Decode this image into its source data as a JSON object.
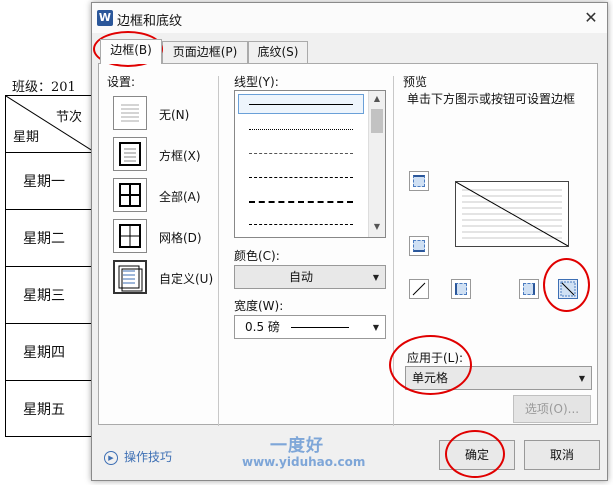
{
  "document": {
    "class_label": "班级：201",
    "header_top": "节次",
    "header_bottom": "星期",
    "rows": [
      "星期一",
      "星期二",
      "星期三",
      "星期四",
      "星期五"
    ]
  },
  "dialog": {
    "app_icon": "W",
    "title": "边框和底纹",
    "close_symbol": "✕",
    "tabs": [
      "边框(B)",
      "页面边框(P)",
      "底纹(S)"
    ],
    "settings_label": "设置:",
    "settings": [
      "无(N)",
      "方框(X)",
      "全部(A)",
      "网格(D)",
      "自定义(U)"
    ],
    "line_style_label": "线型(Y):",
    "color_label": "颜色(C):",
    "color_value": "自动",
    "width_label": "宽度(W):",
    "width_value": "0.5  磅",
    "preview_label": "预览",
    "preview_hint": "单击下方图示或按钮可设置边框",
    "apply_to_label": "应用于(L):",
    "apply_to_value": "单元格",
    "options_button": "选项(O)...",
    "tips_link": "操作技巧",
    "ok_button": "确定",
    "cancel_button": "取消"
  },
  "watermark": {
    "brand": "一度好",
    "url": "www.yiduhao.com"
  },
  "colors": {
    "annotation": "#e00000",
    "link": "#3d6fb4",
    "accent": "#2b579a"
  }
}
